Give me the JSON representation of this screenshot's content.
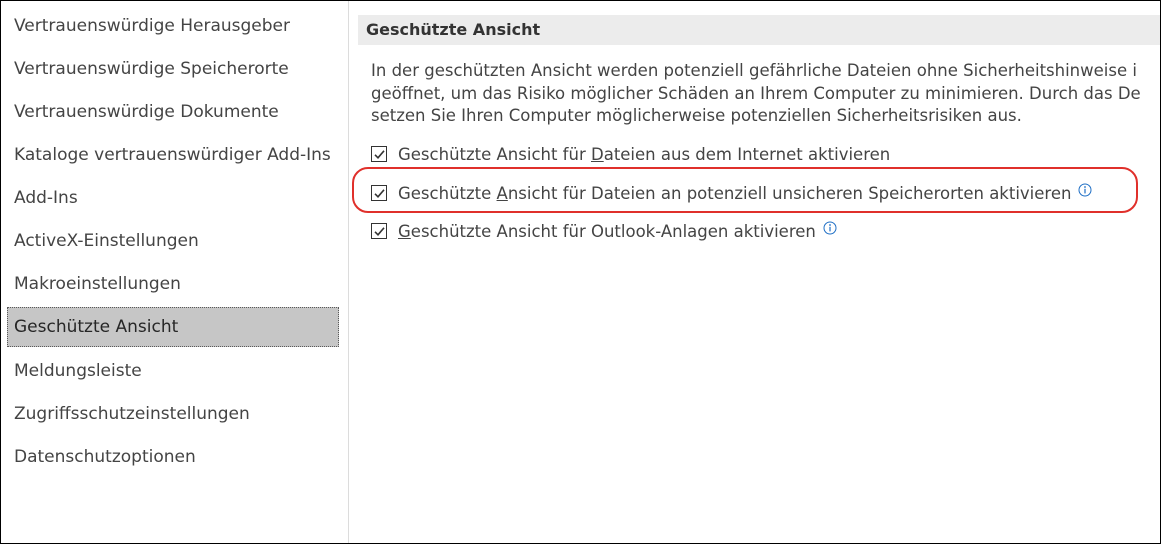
{
  "sidebar": {
    "items": [
      {
        "label": "Vertrauenswürdige Herausgeber"
      },
      {
        "label": "Vertrauenswürdige Speicherorte"
      },
      {
        "label": "Vertrauenswürdige Dokumente"
      },
      {
        "label": "Kataloge vertrauenswürdiger Add-Ins"
      },
      {
        "label": "Add-Ins"
      },
      {
        "label": "ActiveX-Einstellungen"
      },
      {
        "label": "Makroeinstellungen"
      },
      {
        "label": "Geschützte Ansicht"
      },
      {
        "label": "Meldungsleiste"
      },
      {
        "label": "Zugriffsschutzeinstellungen"
      },
      {
        "label": "Datenschutzoptionen"
      }
    ],
    "selected_index": 7
  },
  "main": {
    "section_title": "Geschützte Ansicht",
    "description_lines": [
      "In der geschützten Ansicht werden potenziell gefährliche Dateien ohne Sicherheitshinweise i",
      "geöffnet, um das Risiko möglicher Schäden an Ihrem Computer zu minimieren. Durch das De",
      "setzen Sie Ihren Computer möglicherweise potenziellen Sicherheitsrisiken aus."
    ],
    "options": [
      {
        "pre": "Geschützte Ansicht für ",
        "accel": "D",
        "post": "ateien aus dem Internet aktivieren",
        "checked": true,
        "info": false
      },
      {
        "pre": "Geschützte ",
        "accel": "A",
        "post": "nsicht für Dateien an potenziell unsicheren Speicherorten aktivieren",
        "checked": true,
        "info": true
      },
      {
        "pre": "",
        "accel": "G",
        "post": "eschützte Ansicht für Outlook-Anlagen aktivieren",
        "checked": true,
        "info": true
      }
    ]
  },
  "colors": {
    "selected_bg": "#c6c6c6",
    "header_bg": "#ececec",
    "highlight": "#e0302b",
    "info_icon": "#1f6fc5"
  },
  "icons": {
    "check": "checkmark-icon",
    "info": "info-icon"
  }
}
